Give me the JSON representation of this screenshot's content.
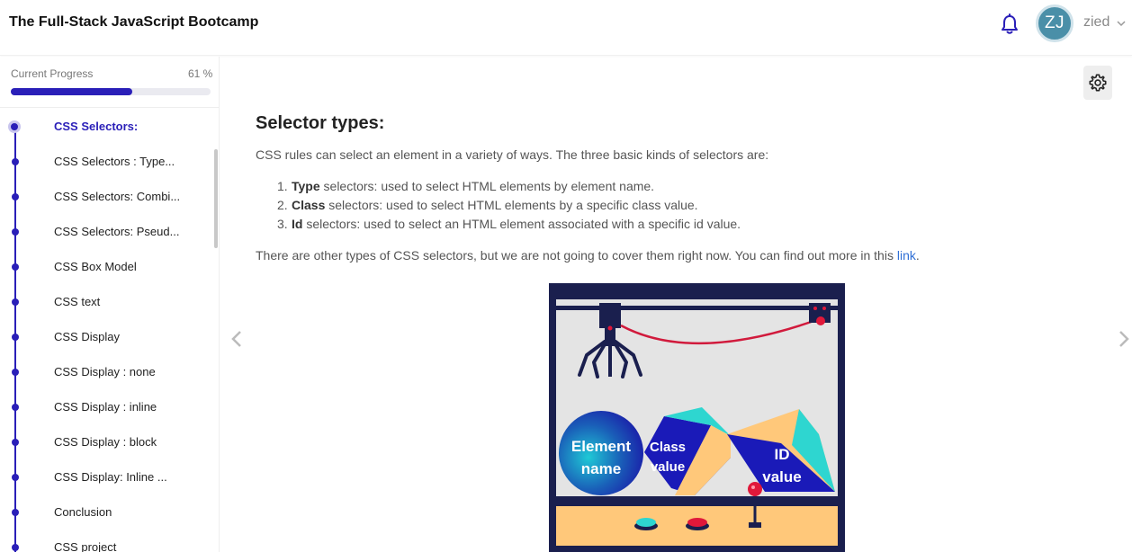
{
  "app": {
    "title": "The Full-Stack JavaScript Bootcamp"
  },
  "user": {
    "initials": "ZJ",
    "name": "zied"
  },
  "colors": {
    "accent": "#2a1fb8",
    "avatar": "#4a8fa8",
    "link": "#2f6fd6"
  },
  "icons": {
    "notifications": "bell-icon",
    "settings": "gear-icon",
    "prev": "chevron-left-icon",
    "next": "chevron-right-icon",
    "menu": "chevron-down-icon"
  },
  "progress": {
    "label": "Current Progress",
    "percent_text": "61 %",
    "value": 0.61
  },
  "lessons": [
    {
      "label": "CSS Selectors:",
      "active": true
    },
    {
      "label": "CSS Selectors : Type..."
    },
    {
      "label": "CSS Selectors: Combi..."
    },
    {
      "label": "CSS Selectors: Pseud..."
    },
    {
      "label": "CSS Box Model"
    },
    {
      "label": "CSS text"
    },
    {
      "label": "CSS Display"
    },
    {
      "label": "CSS Display : none"
    },
    {
      "label": "CSS Display : inline"
    },
    {
      "label": "CSS Display : block"
    },
    {
      "label": "CSS Display: Inline ..."
    },
    {
      "label": "Conclusion"
    },
    {
      "label": "CSS project"
    }
  ],
  "content": {
    "heading": "Selector types:",
    "intro": "CSS rules can select an element in a variety of ways. The three basic kinds of selectors are:",
    "selectors": [
      {
        "num": "1.",
        "term": "Type",
        "desc": " selectors: used to select HTML elements by element name."
      },
      {
        "num": "2.",
        "term": "Class",
        "desc": " selectors: used to select HTML elements by a specific class value."
      },
      {
        "num": "3.",
        "term": "Id",
        "desc": " selectors: used to select an HTML element associated with a specific id value."
      }
    ],
    "outro_text": "There are other types of CSS selectors, but we are not going to cover them right now. You can find out more in this ",
    "outro_link": "link",
    "outro_end": ".",
    "illustration": {
      "element_label_1": "Element",
      "element_label_2": "name",
      "class_label_1": "Class",
      "class_label_2": "value",
      "id_label_1": "ID",
      "id_label_2": "value"
    }
  }
}
